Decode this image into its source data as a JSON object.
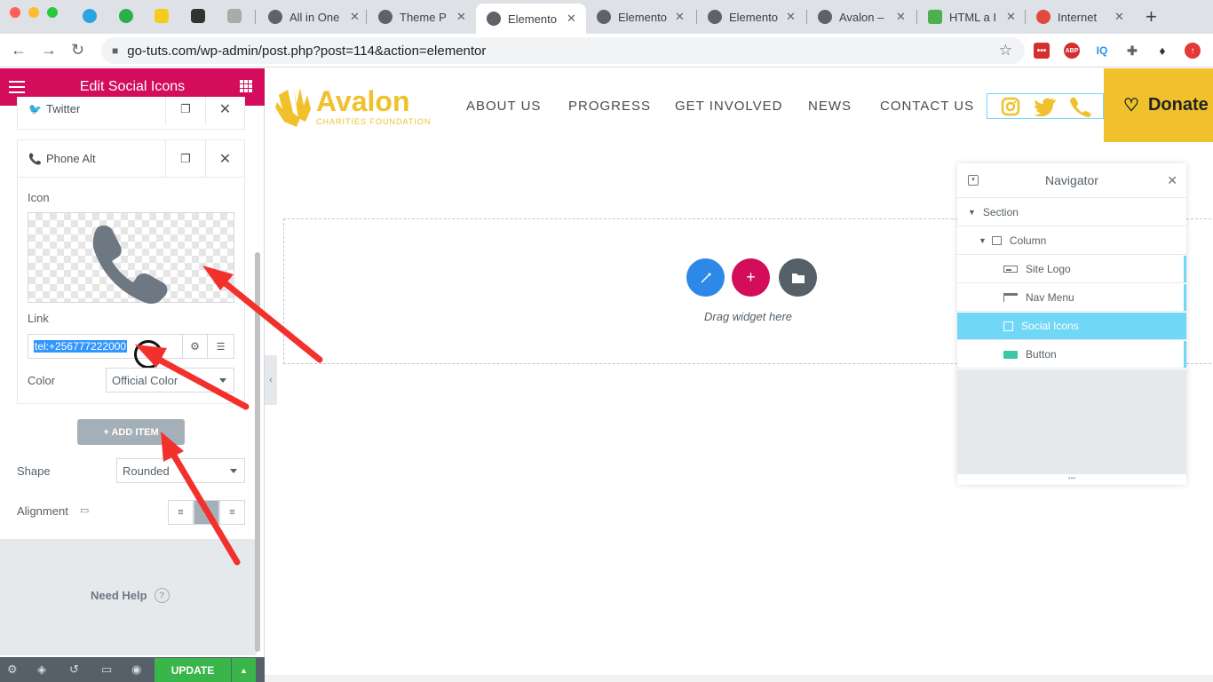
{
  "browser": {
    "tabs": [
      {
        "label": "All in One"
      },
      {
        "label": "Theme P"
      },
      {
        "label": "Elemento"
      },
      {
        "label": "Elemento"
      },
      {
        "label": "Elemento"
      },
      {
        "label": "Avalon –"
      },
      {
        "label": "HTML a I"
      },
      {
        "label": "Internet"
      }
    ],
    "new_tab": "+",
    "url": "go-tuts.com/wp-admin/post.php?post=114&action=elementor",
    "ext_abp": "ABP",
    "ext_iq": "IQ"
  },
  "panel": {
    "title": "Edit Social Icons",
    "items": [
      {
        "label": "Twitter"
      },
      {
        "label": "Phone Alt"
      }
    ],
    "icon_label": "Icon",
    "link_label": "Link",
    "link_value": "tel:+256777222000",
    "color_label": "Color",
    "color_value": "Official Color",
    "add_item": "+ ADD ITEM",
    "shape_label": "Shape",
    "shape_value": "Rounded",
    "alignment_label": "Alignment",
    "need_help": "Need Help",
    "update": "UPDATE"
  },
  "site": {
    "logo": "Avalon",
    "tagline": "CHARITIES FOUNDATION",
    "menu": [
      "ABOUT US",
      "PROGRESS",
      "GET INVOLVED",
      "NEWS",
      "CONTACT US"
    ],
    "donate": "Donate",
    "drag_text": "Drag widget here"
  },
  "navigator": {
    "title": "Navigator",
    "rows": [
      {
        "label": "Section"
      },
      {
        "label": "Column"
      },
      {
        "label": "Site Logo"
      },
      {
        "label": "Nav Menu"
      },
      {
        "label": "Social Icons"
      },
      {
        "label": "Button"
      }
    ]
  },
  "colors": {
    "elementor_header": "#d30c5c",
    "update_green": "#39b54a",
    "donate_yellow": "#f0c12c",
    "navigator_active": "#71d7f7",
    "annotation_red": "#f2312d"
  }
}
